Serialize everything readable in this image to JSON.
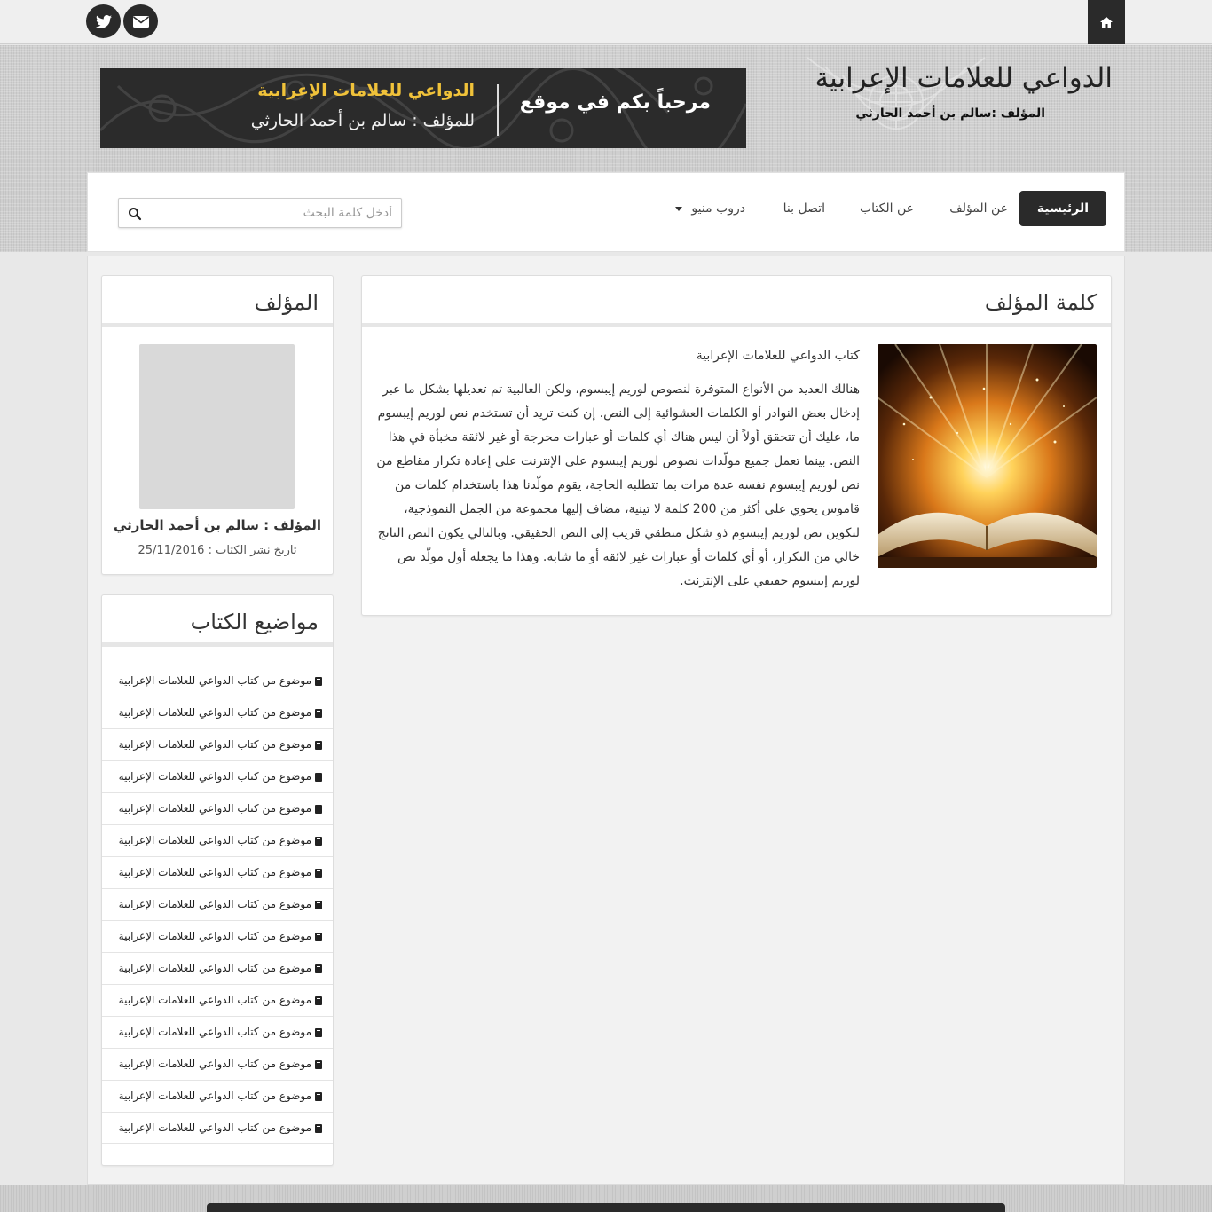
{
  "site": {
    "title": "الدواعي للعلامات الإعرابية",
    "subtitle": "المؤلف :سالم بن أحمد الحارثي"
  },
  "banner": {
    "welcome": "مرحباً بكم في موقع",
    "book_title": "الدواعي للعلامات الإعرابية",
    "author": "للمؤلف : سالم بن أحمد الحارثي"
  },
  "topbar": {
    "icons": [
      "home-icon",
      "twitter-icon",
      "envelope-icon"
    ]
  },
  "nav": {
    "items": [
      {
        "label": "الرئيسية",
        "active": true
      },
      {
        "label": "عن المؤلف"
      },
      {
        "label": "عن الكتاب"
      },
      {
        "label": "اتصل بنا"
      },
      {
        "label": "دروب منيو"
      }
    ],
    "search_placeholder": "أدخل كلمة البحث"
  },
  "article": {
    "heading": "كلمة المؤلف",
    "lead": "كتاب الدواعي للعلامات الإعرابية",
    "body": "هنالك العديد من الأنواع المتوفرة لنصوص لوريم إيبسوم، ولكن الغالبية تم تعديلها بشكل ما عبر إدخال بعض النوادر أو الكلمات العشوائية إلى النص. إن كنت تريد أن تستخدم نص لوريم إيبسوم ما، عليك أن تتحقق أولاً أن ليس هناك أي كلمات أو عبارات محرجة أو غير لائقة مخبأة في هذا النص. بينما تعمل جميع مولّدات نصوص لوريم إيبسوم على الإنترنت على إعادة تكرار مقاطع من نص لوريم إيبسوم نفسه عدة مرات بما تتطلبه الحاجة، يقوم مولّدنا هذا باستخدام كلمات من قاموس يحوي على أكثر من 200 كلمة لا تينية، مضاف إليها مجموعة من الجمل النموذجية، لتكوين نص لوريم إيبسوم ذو شكل منطقي قريب إلى النص الحقيقي. وبالتالي يكون النص الناتج خالي من التكرار، أو أي كلمات أو عبارات غير لائقة أو ما شابه. وهذا ما يجعله أول مولّد نص لوريم إيبسوم حقيقي على الإنترنت."
  },
  "author_widget": {
    "heading": "المؤلف",
    "name": "المؤلف : سالم بن أحمد الحارثي",
    "pub_date": "تاريخ نشر الكتاب : 25/11/2016"
  },
  "topics_widget": {
    "heading": "مواضيع الكتاب",
    "items": [
      "موضوع من كتاب الدواعي للعلامات الإعرابية",
      "موضوع من كتاب الدواعي للعلامات الإعرابية",
      "موضوع من كتاب الدواعي للعلامات الإعرابية",
      "موضوع من كتاب الدواعي للعلامات الإعرابية",
      "موضوع من كتاب الدواعي للعلامات الإعرابية",
      "موضوع من كتاب الدواعي للعلامات الإعرابية",
      "موضوع من كتاب الدواعي للعلامات الإعرابية",
      "موضوع من كتاب الدواعي للعلامات الإعرابية",
      "موضوع من كتاب الدواعي للعلامات الإعرابية",
      "موضوع من كتاب الدواعي للعلامات الإعرابية",
      "موضوع من كتاب الدواعي للعلامات الإعرابية",
      "موضوع من كتاب الدواعي للعلامات الإعرابية",
      "موضوع من كتاب الدواعي للعلامات الإعرابية",
      "موضوع من كتاب الدواعي للعلامات الإعرابية",
      "موضوع من كتاب الدواعي للعلامات الإعرابية"
    ]
  },
  "colors": {
    "dark": "#2a2a2a",
    "gold": "#f0c23a",
    "panel_bg": "#ffffff",
    "page_bg": "#f2f2f2"
  }
}
